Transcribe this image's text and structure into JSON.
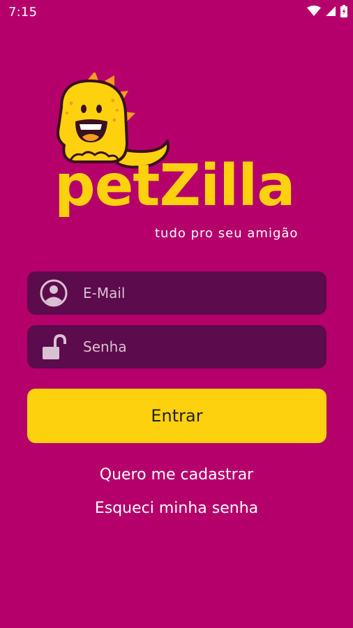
{
  "status_bar": {
    "time": "7:15",
    "icons": [
      "wifi-icon",
      "signal-icon",
      "battery-icon"
    ]
  },
  "brand": {
    "name": "petZilla",
    "tagline": "tudo pro seu amigão",
    "mascot_icon": "dinosaur-mascot",
    "colors": {
      "background": "#b5006b",
      "accent": "#fdd10d",
      "field_background": "#5c0b4c"
    }
  },
  "login_form": {
    "email_placeholder": "E-Mail",
    "email_value": "",
    "email_icon": "user-icon",
    "password_placeholder": "Senha",
    "password_value": "",
    "password_icon": "unlock-icon",
    "submit_label": "Entrar"
  },
  "links": {
    "register": "Quero me cadastrar",
    "forgot_password": "Esqueci minha senha"
  }
}
